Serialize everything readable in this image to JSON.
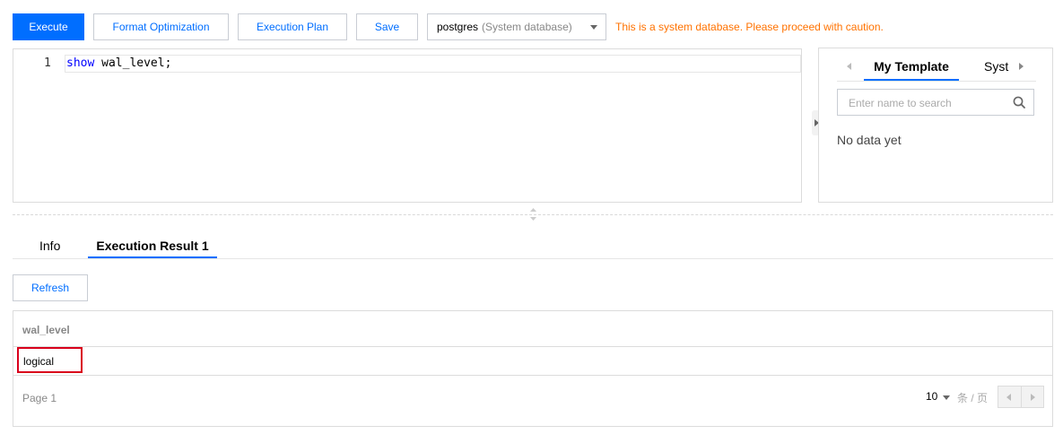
{
  "toolbar": {
    "execute_label": "Execute",
    "format_label": "Format Optimization",
    "plan_label": "Execution Plan",
    "save_label": "Save",
    "database": {
      "selected": "postgres",
      "selected_hint": "(System database)"
    },
    "warning": "This is a system database. Please proceed with caution."
  },
  "editor": {
    "lines": [
      {
        "number": "1",
        "keyword": "show",
        "rest": " wal_level;"
      }
    ]
  },
  "side_panel": {
    "tabs": {
      "my_template": "My Template",
      "system": "System Template"
    },
    "search_placeholder": "Enter name to search",
    "empty_text": "No data yet"
  },
  "results": {
    "tabs": {
      "info": "Info",
      "result": "Execution Result 1"
    },
    "refresh_label": "Refresh",
    "table": {
      "columns": [
        "wal_level"
      ],
      "rows": [
        [
          "logical"
        ]
      ]
    },
    "pagination": {
      "page_text": "Page 1",
      "page_size": "10",
      "per_page_unit": "条 / 页"
    }
  },
  "colors": {
    "primary": "#006eff",
    "warning": "#ff7200",
    "highlight_border": "#d9001b"
  }
}
